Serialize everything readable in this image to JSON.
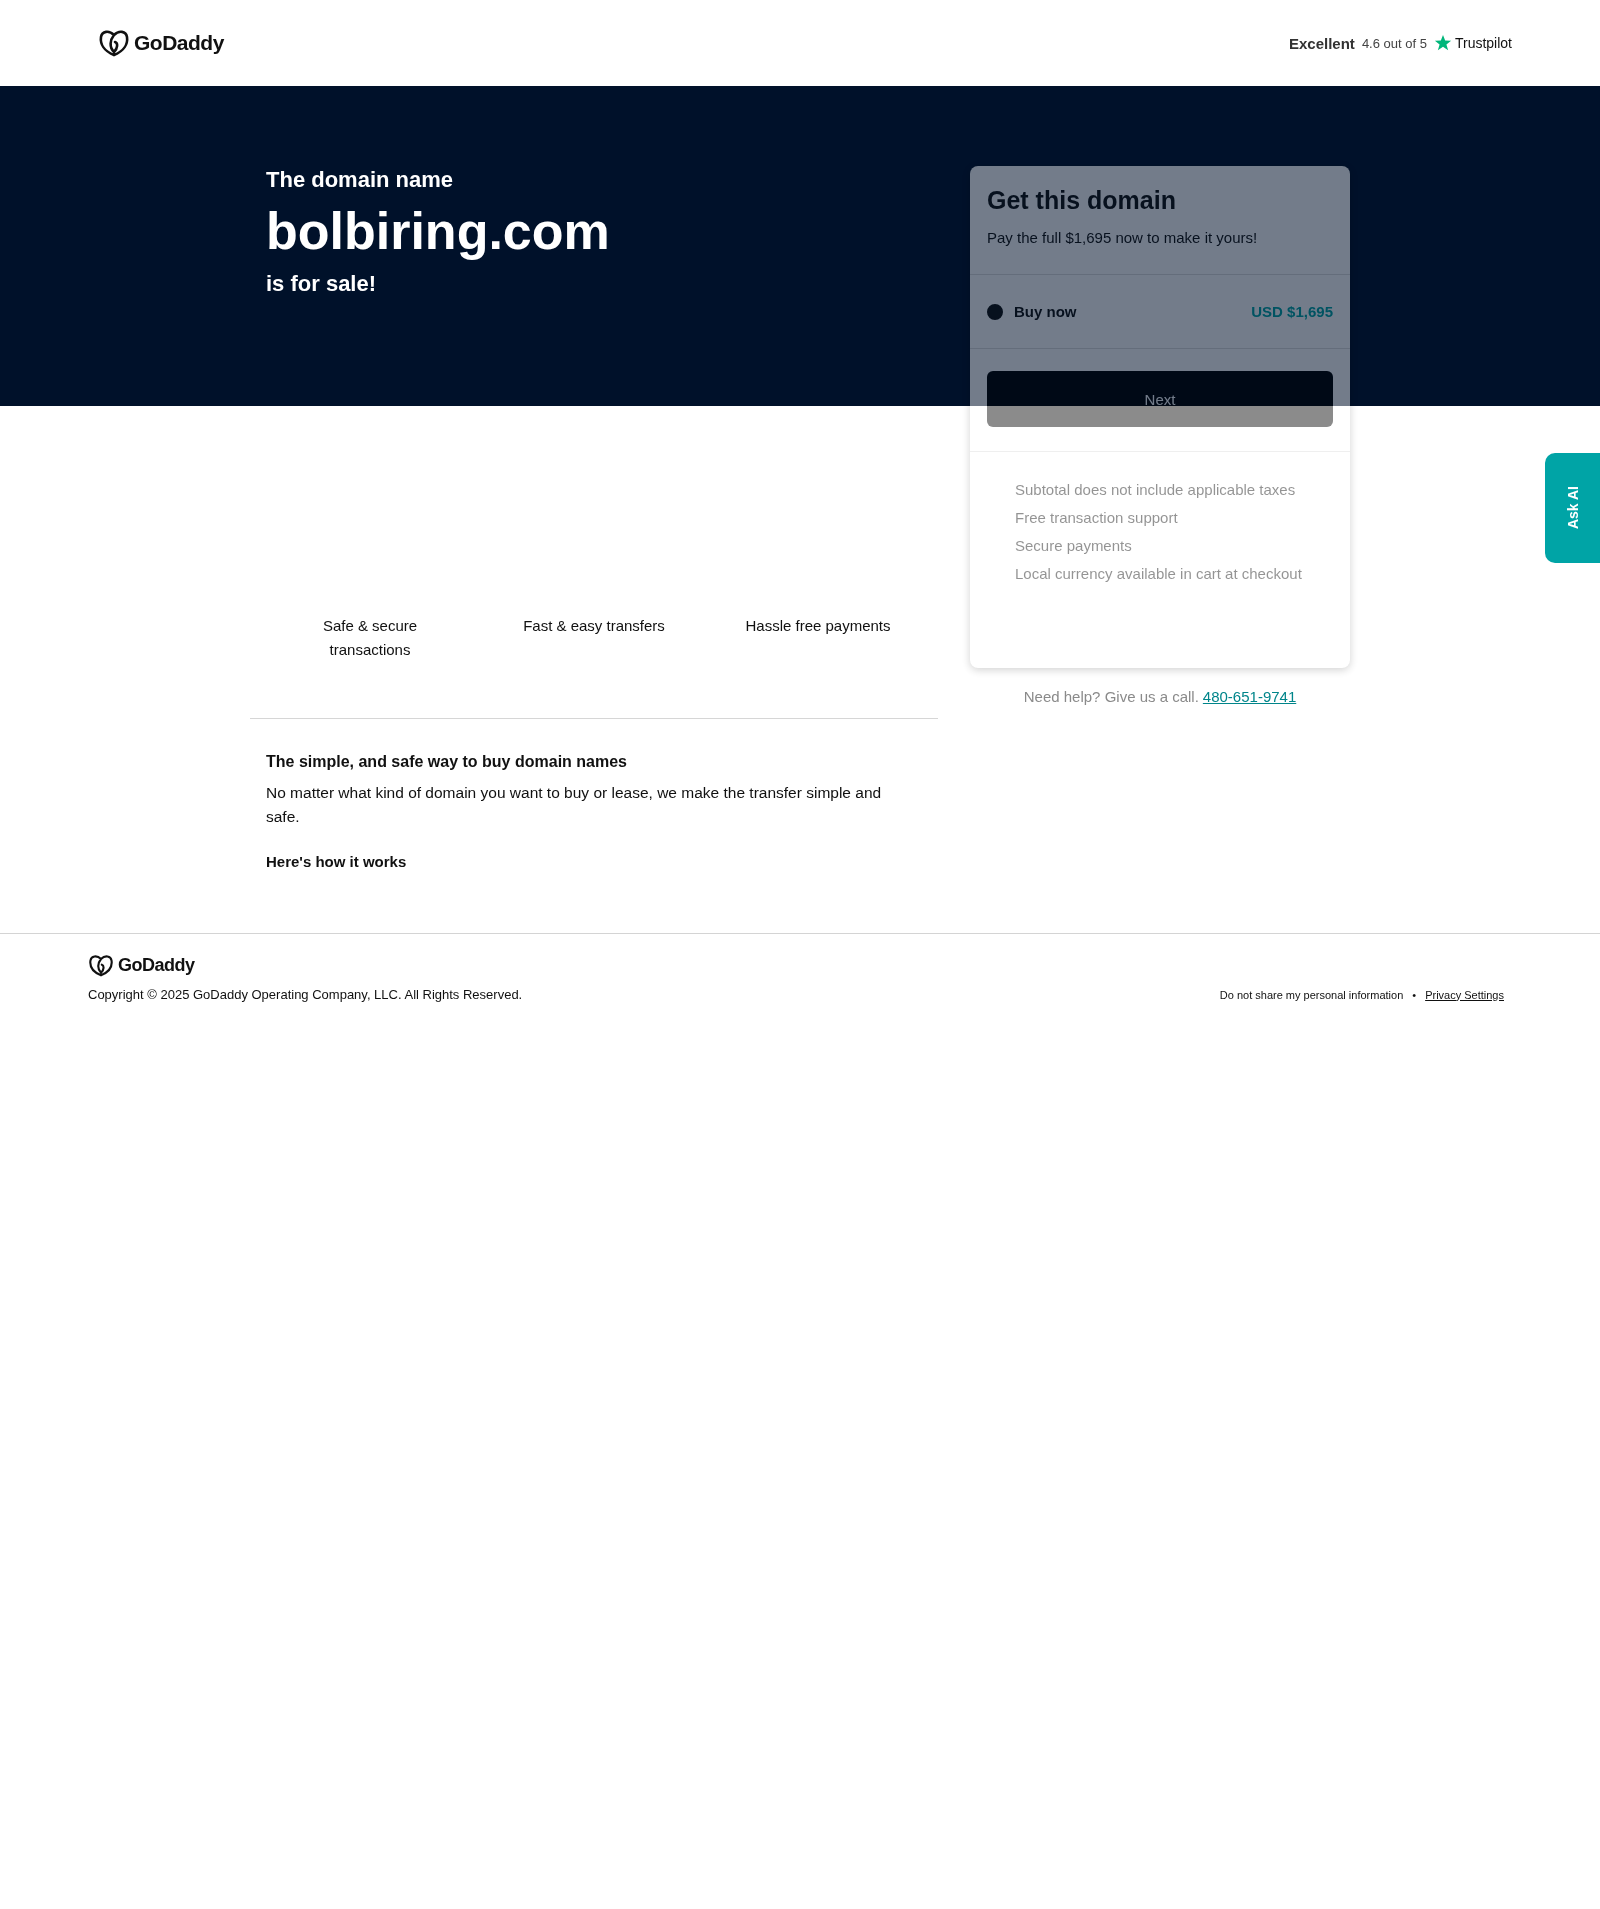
{
  "header": {
    "logo": "GoDaddy",
    "rating": {
      "label": "Excellent",
      "score": "4.6 out of 5",
      "brand": "Trustpilot"
    }
  },
  "hero": {
    "intro": "The domain name",
    "domain": "bolbiring.com",
    "outro": "is for sale!"
  },
  "purchase_card": {
    "title": "Get this domain",
    "subtitle": "Pay the full $1,695 now to make it yours!",
    "options": [
      {
        "label": "Buy now",
        "price": "USD $1,695",
        "selected": true
      }
    ],
    "button": "Next",
    "notes": [
      "Subtotal does not include applicable taxes",
      "Free transaction support",
      "Secure payments",
      "Local currency available in cart at checkout"
    ],
    "help": {
      "text": "Need help? Give us a call.",
      "phone": "480-651-9741"
    }
  },
  "features": [
    "Safe & secure transactions",
    "Fast & easy transfers",
    "Hassle free payments"
  ],
  "info": {
    "heading": "The simple, and safe way to buy domain names",
    "body": "No matter what kind of domain you want to buy or lease, we make the transfer simple and safe.",
    "link": "Here's how it works"
  },
  "footer": {
    "logo": "GoDaddy",
    "copyright": "Copyright © 2025 GoDaddy Operating Company, LLC. All Rights Reserved.",
    "links": [
      "Do not share my personal information",
      "Privacy Settings"
    ],
    "separator": "•"
  },
  "ask_ai": "Ask AI"
}
